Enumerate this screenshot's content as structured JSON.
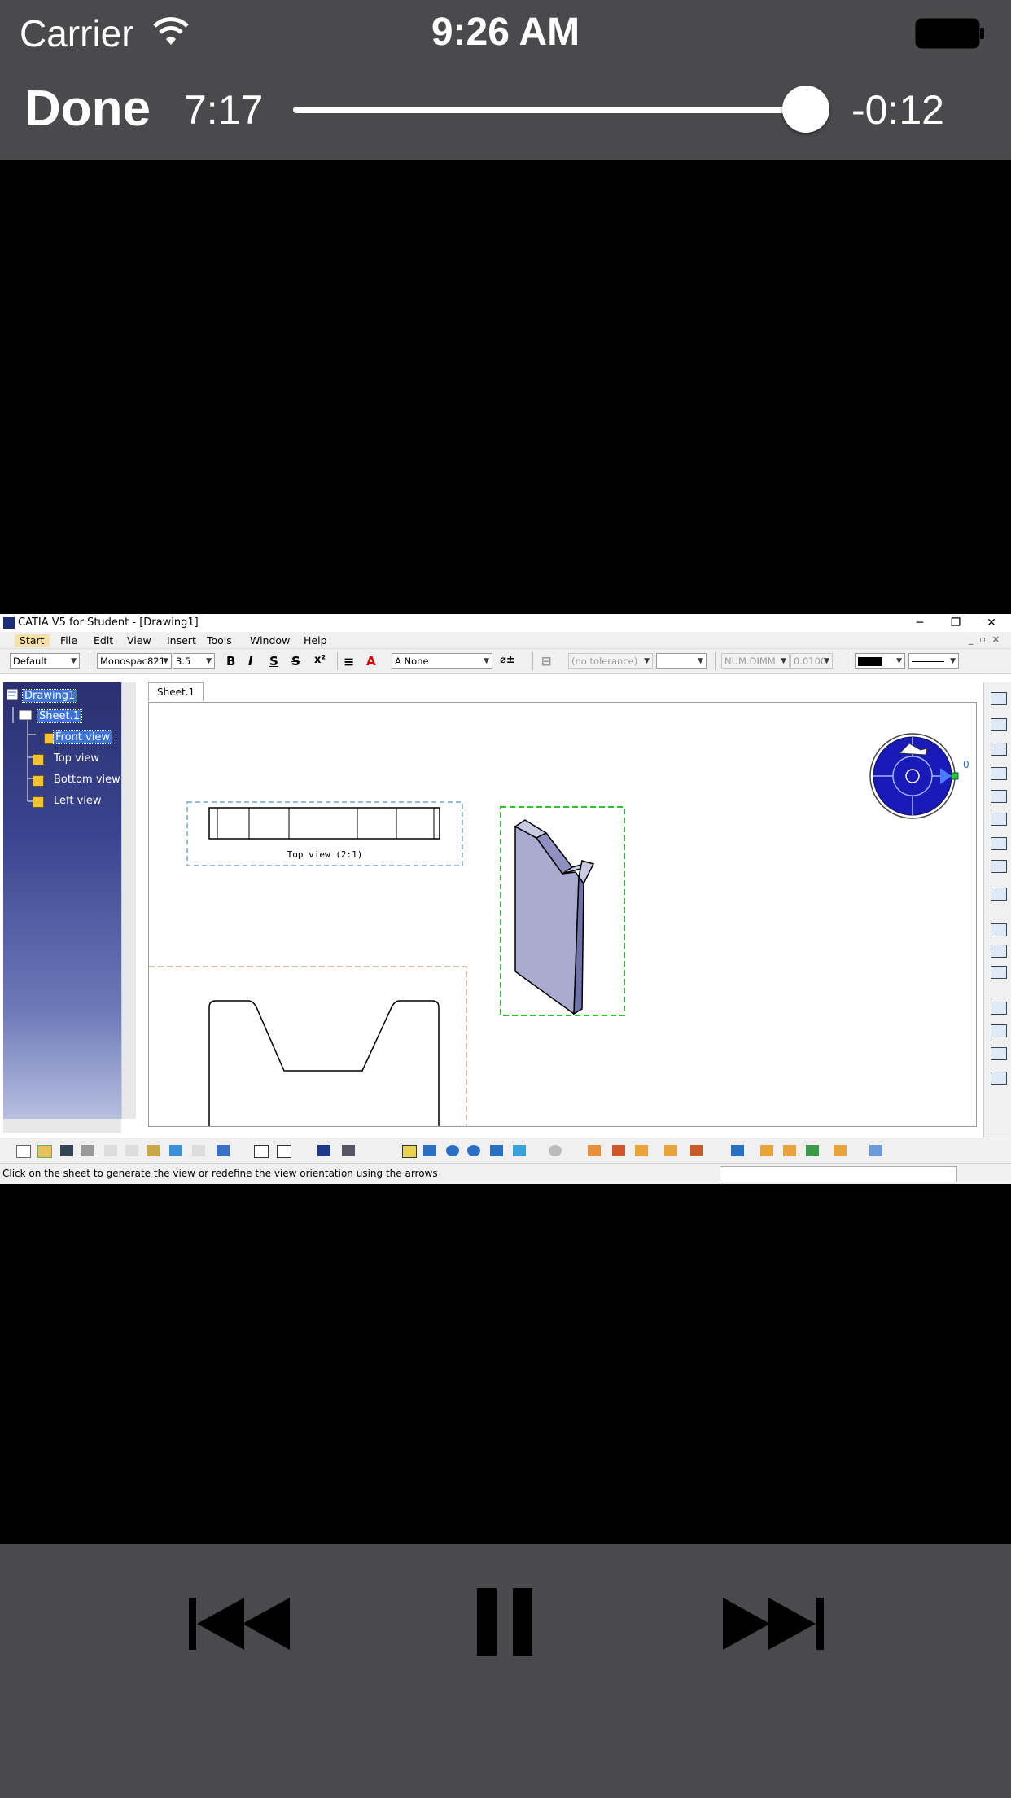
{
  "status_bar": {
    "carrier": "Carrier",
    "time": "9:26 AM"
  },
  "player": {
    "done_label": "Done",
    "elapsed": "7:17",
    "remaining": "-0:12",
    "progress": 0.96
  },
  "app": {
    "title": "CATIA V5 for Student - [Drawing1]",
    "menus": [
      "Start",
      "File",
      "Edit",
      "View",
      "Insert",
      "Tools",
      "Window",
      "Help"
    ],
    "toolbar": {
      "style": "Default",
      "font": "Monospac821",
      "size": "3.5",
      "bold": "B",
      "italic": "I",
      "underline": "S",
      "strike": "S",
      "superscript": "x²",
      "frame": "None",
      "tolerance": "(no tolerance)",
      "numdim": "NUM.DIMM",
      "precision": "0.0100"
    },
    "tree": {
      "root": "Drawing1",
      "sheet": "Sheet.1",
      "views": [
        "Front view",
        "Top view",
        "Bottom view",
        "Left view"
      ]
    },
    "sheet_tab": "Sheet.1",
    "top_view_label": "Top view (2:1)",
    "compass_value": "0",
    "status_message": "Click on the sheet to generate the view or redefine the view orientation using the arrows"
  }
}
